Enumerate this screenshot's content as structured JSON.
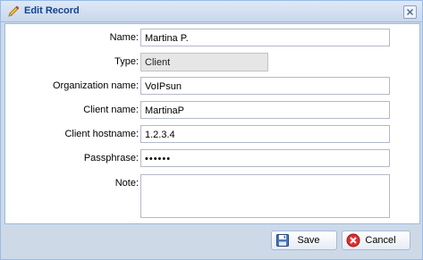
{
  "window": {
    "title": "Edit Record",
    "icon": "pencil-icon",
    "close_icon": "close-icon"
  },
  "form": {
    "name": {
      "label": "Name:",
      "value": "Martina P."
    },
    "type": {
      "label": "Type:",
      "value": "Client"
    },
    "organization": {
      "label": "Organization name:",
      "value": "VoIPsun"
    },
    "client_name": {
      "label": "Client name:",
      "value": "MartinaP"
    },
    "client_hostname": {
      "label": "Client hostname:",
      "value": "1.2.3.4"
    },
    "passphrase": {
      "label": "Passphrase:",
      "value": "••••••"
    },
    "note": {
      "label": "Note:",
      "value": ""
    }
  },
  "buttons": {
    "save": {
      "label": "Save",
      "icon": "floppy-disk-icon"
    },
    "cancel": {
      "label": "Cancel",
      "icon": "cancel-icon"
    }
  }
}
